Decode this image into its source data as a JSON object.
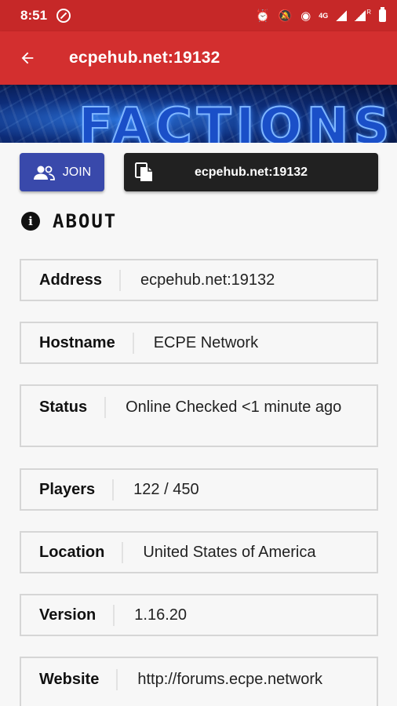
{
  "status_bar": {
    "time": "8:51",
    "icons": [
      "alarm-icon",
      "mute-icon",
      "hotspot-icon",
      "4g-icon",
      "signal-icon",
      "signal-r-icon",
      "battery-icon"
    ],
    "network_label": "4G",
    "roaming_label": "R"
  },
  "app_bar": {
    "title": "ecpehub.net:19132",
    "back_icon": "arrow-left-icon",
    "color": "#d32f2f"
  },
  "banner": {
    "text": "FACTIONS"
  },
  "actions": {
    "join_label": "JOIN",
    "copy_label": "ecpehub.net:19132",
    "join_color": "#3949ab",
    "copy_color": "#212121"
  },
  "about": {
    "title": "ABOUT"
  },
  "info": [
    {
      "label": "Address",
      "value": "ecpehub.net:19132"
    },
    {
      "label": "Hostname",
      "value": "ECPE Network"
    },
    {
      "label": "Status",
      "value": "Online Checked <1 minute ago"
    },
    {
      "label": "Players",
      "value": "122 / 450"
    },
    {
      "label": "Location",
      "value": "United States of America"
    },
    {
      "label": "Version",
      "value": "1.16.20"
    },
    {
      "label": "Website",
      "value": "http://forums.ecpe.network"
    }
  ]
}
